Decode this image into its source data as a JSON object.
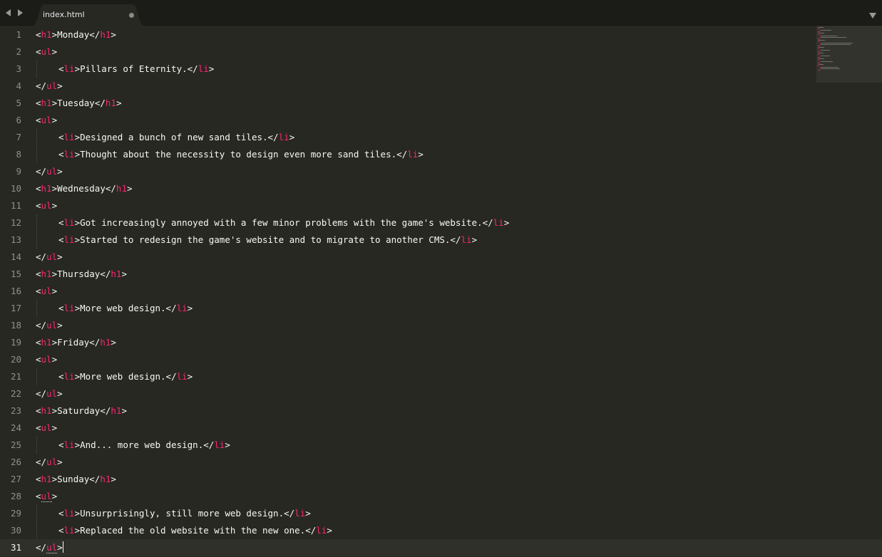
{
  "window": {
    "title": "index.html"
  },
  "tabbar": {
    "back_icon": "left-arrow-icon",
    "forward_icon": "right-arrow-icon",
    "tab": {
      "label": "index.html",
      "dirty": true
    },
    "menu_icon": "chevron-down-icon"
  },
  "editor": {
    "current_line": 31,
    "lines": [
      {
        "n": "1",
        "indent": false,
        "parts": [
          [
            "p",
            "<"
          ],
          [
            "t",
            "h1"
          ],
          [
            "p",
            ">"
          ],
          [
            "x",
            "Monday"
          ],
          [
            "p",
            "</"
          ],
          [
            "t",
            "h1"
          ],
          [
            "p",
            ">"
          ]
        ]
      },
      {
        "n": "2",
        "indent": false,
        "parts": [
          [
            "p",
            "<"
          ],
          [
            "t",
            "ul"
          ],
          [
            "p",
            ">"
          ]
        ]
      },
      {
        "n": "3",
        "indent": true,
        "parts": [
          [
            "p",
            "<"
          ],
          [
            "t",
            "li"
          ],
          [
            "p",
            ">"
          ],
          [
            "x",
            "Pillars of Eternity."
          ],
          [
            "p",
            "</"
          ],
          [
            "t",
            "li"
          ],
          [
            "p",
            ">"
          ]
        ]
      },
      {
        "n": "4",
        "indent": false,
        "parts": [
          [
            "p",
            "</"
          ],
          [
            "t",
            "ul"
          ],
          [
            "p",
            ">"
          ]
        ]
      },
      {
        "n": "5",
        "indent": false,
        "parts": [
          [
            "p",
            "<"
          ],
          [
            "t",
            "h1"
          ],
          [
            "p",
            ">"
          ],
          [
            "x",
            "Tuesday"
          ],
          [
            "p",
            "</"
          ],
          [
            "t",
            "h1"
          ],
          [
            "p",
            ">"
          ]
        ]
      },
      {
        "n": "6",
        "indent": false,
        "parts": [
          [
            "p",
            "<"
          ],
          [
            "t",
            "ul"
          ],
          [
            "p",
            ">"
          ]
        ]
      },
      {
        "n": "7",
        "indent": true,
        "parts": [
          [
            "p",
            "<"
          ],
          [
            "t",
            "li"
          ],
          [
            "p",
            ">"
          ],
          [
            "x",
            "Designed a bunch of new sand tiles."
          ],
          [
            "p",
            "</"
          ],
          [
            "t",
            "li"
          ],
          [
            "p",
            ">"
          ]
        ]
      },
      {
        "n": "8",
        "indent": true,
        "parts": [
          [
            "p",
            "<"
          ],
          [
            "t",
            "li"
          ],
          [
            "p",
            ">"
          ],
          [
            "x",
            "Thought about the necessity to design even more sand tiles."
          ],
          [
            "p",
            "</"
          ],
          [
            "t",
            "li"
          ],
          [
            "p",
            ">"
          ]
        ]
      },
      {
        "n": "9",
        "indent": false,
        "parts": [
          [
            "p",
            "</"
          ],
          [
            "t",
            "ul"
          ],
          [
            "p",
            ">"
          ]
        ]
      },
      {
        "n": "10",
        "indent": false,
        "parts": [
          [
            "p",
            "<"
          ],
          [
            "t",
            "h1"
          ],
          [
            "p",
            ">"
          ],
          [
            "x",
            "Wednesday"
          ],
          [
            "p",
            "</"
          ],
          [
            "t",
            "h1"
          ],
          [
            "p",
            ">"
          ]
        ]
      },
      {
        "n": "11",
        "indent": false,
        "parts": [
          [
            "p",
            "<"
          ],
          [
            "t",
            "ul"
          ],
          [
            "p",
            ">"
          ]
        ]
      },
      {
        "n": "12",
        "indent": true,
        "parts": [
          [
            "p",
            "<"
          ],
          [
            "t",
            "li"
          ],
          [
            "p",
            ">"
          ],
          [
            "x",
            "Got increasingly annoyed with a few minor problems with the game's website."
          ],
          [
            "p",
            "</"
          ],
          [
            "t",
            "li"
          ],
          [
            "p",
            ">"
          ]
        ]
      },
      {
        "n": "13",
        "indent": true,
        "parts": [
          [
            "p",
            "<"
          ],
          [
            "t",
            "li"
          ],
          [
            "p",
            ">"
          ],
          [
            "x",
            "Started to redesign the game's website and to migrate to another CMS."
          ],
          [
            "p",
            "</"
          ],
          [
            "t",
            "li"
          ],
          [
            "p",
            ">"
          ]
        ]
      },
      {
        "n": "14",
        "indent": false,
        "parts": [
          [
            "p",
            "</"
          ],
          [
            "t",
            "ul"
          ],
          [
            "p",
            ">"
          ]
        ]
      },
      {
        "n": "15",
        "indent": false,
        "parts": [
          [
            "p",
            "<"
          ],
          [
            "t",
            "h1"
          ],
          [
            "p",
            ">"
          ],
          [
            "x",
            "Thursday"
          ],
          [
            "p",
            "</"
          ],
          [
            "t",
            "h1"
          ],
          [
            "p",
            ">"
          ]
        ]
      },
      {
        "n": "16",
        "indent": false,
        "parts": [
          [
            "p",
            "<"
          ],
          [
            "t",
            "ul"
          ],
          [
            "p",
            ">"
          ]
        ]
      },
      {
        "n": "17",
        "indent": true,
        "parts": [
          [
            "p",
            "<"
          ],
          [
            "t",
            "li"
          ],
          [
            "p",
            ">"
          ],
          [
            "x",
            "More web design."
          ],
          [
            "p",
            "</"
          ],
          [
            "t",
            "li"
          ],
          [
            "p",
            ">"
          ]
        ]
      },
      {
        "n": "18",
        "indent": false,
        "parts": [
          [
            "p",
            "</"
          ],
          [
            "t",
            "ul"
          ],
          [
            "p",
            ">"
          ]
        ]
      },
      {
        "n": "19",
        "indent": false,
        "parts": [
          [
            "p",
            "<"
          ],
          [
            "t",
            "h1"
          ],
          [
            "p",
            ">"
          ],
          [
            "x",
            "Friday"
          ],
          [
            "p",
            "</"
          ],
          [
            "t",
            "h1"
          ],
          [
            "p",
            ">"
          ]
        ]
      },
      {
        "n": "20",
        "indent": false,
        "parts": [
          [
            "p",
            "<"
          ],
          [
            "t",
            "ul"
          ],
          [
            "p",
            ">"
          ]
        ]
      },
      {
        "n": "21",
        "indent": true,
        "parts": [
          [
            "p",
            "<"
          ],
          [
            "t",
            "li"
          ],
          [
            "p",
            ">"
          ],
          [
            "x",
            "More web design."
          ],
          [
            "p",
            "</"
          ],
          [
            "t",
            "li"
          ],
          [
            "p",
            ">"
          ]
        ]
      },
      {
        "n": "22",
        "indent": false,
        "parts": [
          [
            "p",
            "</"
          ],
          [
            "t",
            "ul"
          ],
          [
            "p",
            ">"
          ]
        ]
      },
      {
        "n": "23",
        "indent": false,
        "parts": [
          [
            "p",
            "<"
          ],
          [
            "t",
            "h1"
          ],
          [
            "p",
            ">"
          ],
          [
            "x",
            "Saturday"
          ],
          [
            "p",
            "</"
          ],
          [
            "t",
            "h1"
          ],
          [
            "p",
            ">"
          ]
        ]
      },
      {
        "n": "24",
        "indent": false,
        "parts": [
          [
            "p",
            "<"
          ],
          [
            "t",
            "ul"
          ],
          [
            "p",
            ">"
          ]
        ]
      },
      {
        "n": "25",
        "indent": true,
        "parts": [
          [
            "p",
            "<"
          ],
          [
            "t",
            "li"
          ],
          [
            "p",
            ">"
          ],
          [
            "x",
            "And... more web design."
          ],
          [
            "p",
            "</"
          ],
          [
            "t",
            "li"
          ],
          [
            "p",
            ">"
          ]
        ]
      },
      {
        "n": "26",
        "indent": false,
        "parts": [
          [
            "p",
            "</"
          ],
          [
            "t",
            "ul"
          ],
          [
            "p",
            ">"
          ]
        ]
      },
      {
        "n": "27",
        "indent": false,
        "parts": [
          [
            "p",
            "<"
          ],
          [
            "t",
            "h1"
          ],
          [
            "p",
            ">"
          ],
          [
            "x",
            "Sunday"
          ],
          [
            "p",
            "</"
          ],
          [
            "t",
            "h1"
          ],
          [
            "p",
            ">"
          ]
        ]
      },
      {
        "n": "28",
        "indent": false,
        "parts": [
          [
            "p",
            "<"
          ],
          [
            "u",
            "ul"
          ],
          [
            "p",
            ">"
          ]
        ]
      },
      {
        "n": "29",
        "indent": true,
        "parts": [
          [
            "p",
            "<"
          ],
          [
            "t",
            "li"
          ],
          [
            "p",
            ">"
          ],
          [
            "x",
            "Unsurprisingly, still more web design."
          ],
          [
            "p",
            "</"
          ],
          [
            "t",
            "li"
          ],
          [
            "p",
            ">"
          ]
        ]
      },
      {
        "n": "30",
        "indent": true,
        "parts": [
          [
            "p",
            "<"
          ],
          [
            "t",
            "li"
          ],
          [
            "p",
            ">"
          ],
          [
            "x",
            "Replaced the old website with the new one."
          ],
          [
            "p",
            "</"
          ],
          [
            "t",
            "li"
          ],
          [
            "p",
            ">"
          ]
        ]
      },
      {
        "n": "31",
        "indent": false,
        "parts": [
          [
            "p",
            "</"
          ],
          [
            "u",
            "ul"
          ],
          [
            "p",
            ">"
          ]
        ]
      }
    ]
  },
  "colors": {
    "background": "#272822",
    "tag": "#f92672",
    "text": "#f8f8f2",
    "line_number": "#8f908a",
    "tabbar": "#1b1c18"
  }
}
